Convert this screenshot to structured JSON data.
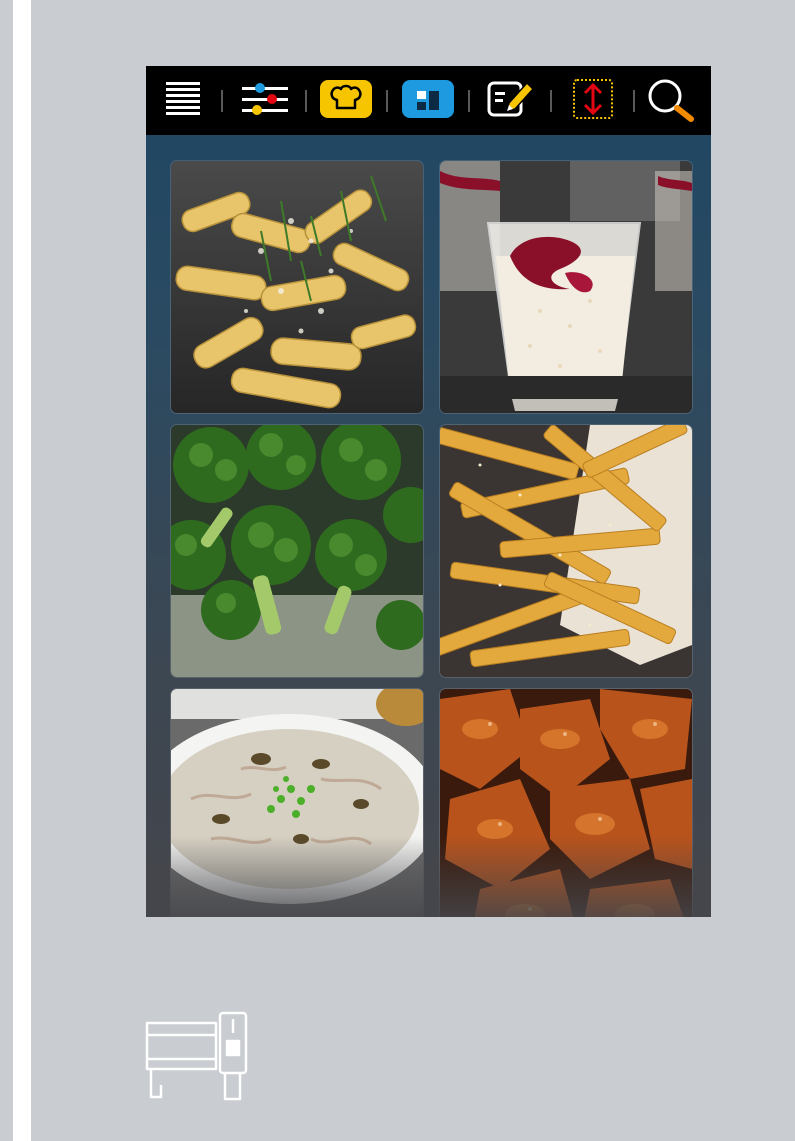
{
  "toolbar": {
    "items": [
      {
        "name": "menu-icon",
        "color": "#ffffff"
      },
      {
        "name": "settings-sliders-icon",
        "colors": [
          "#1e9be0",
          "#e30613",
          "#f7c500"
        ]
      },
      {
        "name": "chef-hat-icon",
        "color": "#f7c500"
      },
      {
        "name": "layout-grid-icon",
        "color": "#1e9be0"
      },
      {
        "name": "edit-icon",
        "colors": [
          "#ffffff",
          "#f7c500"
        ]
      },
      {
        "name": "scroll-height-icon",
        "colors": [
          "#f7c500",
          "#e30613"
        ]
      },
      {
        "name": "search-icon",
        "colors": [
          "#ffffff",
          "#f08a00"
        ]
      }
    ]
  },
  "tiles": [
    {
      "name": "pasta-tile",
      "dish": "penne-pasta"
    },
    {
      "name": "dessert-tile",
      "dish": "cream-dessert"
    },
    {
      "name": "broccoli-tile",
      "dish": "broccoli"
    },
    {
      "name": "fries-tile",
      "dish": "french-fries"
    },
    {
      "name": "soup-tile",
      "dish": "cream-soup"
    },
    {
      "name": "chicken-tile",
      "dish": "glazed-chicken"
    }
  ],
  "device": {
    "name": "appliance-icon",
    "color": "#ffffff"
  }
}
